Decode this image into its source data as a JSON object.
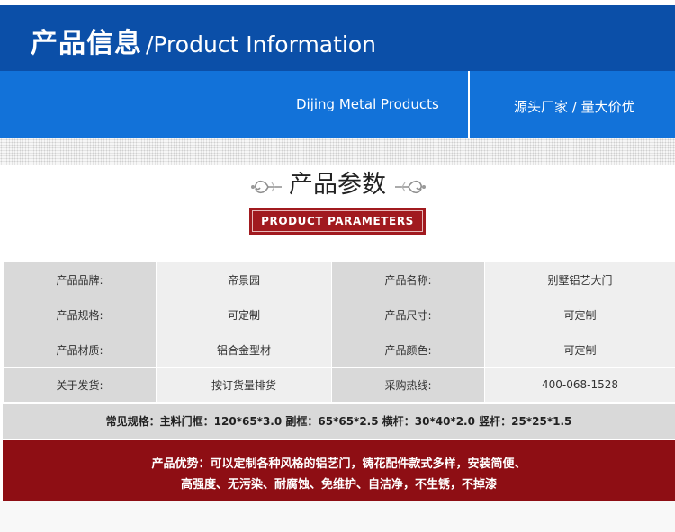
{
  "header": {
    "title_cn": "产品信息",
    "title_en": "/Product Information",
    "band_left": "Dijing Metal Products",
    "band_right": "源头厂家 / 量大价优"
  },
  "section": {
    "title": "产品参数",
    "badge": "PRODUCT PARAMETERS",
    "ornament_left_icon": "floral-scroll-left-icon",
    "ornament_right_icon": "floral-scroll-right-icon"
  },
  "params": {
    "rows": [
      {
        "label1": "产品品牌:",
        "value1": "帝景园",
        "label2": "产品名称:",
        "value2": "别墅铝艺大门"
      },
      {
        "label1": "产品规格:",
        "value1": "可定制",
        "label2": "产品尺寸:",
        "value2": "可定制"
      },
      {
        "label1": "产品材质:",
        "value1": "铝合金型材",
        "label2": "产品颜色:",
        "value2": "可定制"
      },
      {
        "label1": "关于发货:",
        "value1": "按订货量排货",
        "label2": "采购热线:",
        "value2": "400-068-1528"
      }
    ],
    "spec": "常见规格：主料门框：120*65*3.0 副框：65*65*2.5 横杆：30*40*2.0 竖杆：25*25*1.5"
  },
  "advantage": {
    "line1": "产品优势：可以定制各种风格的铝艺门，铸花配件款式多样，安装简便、",
    "line2": "高强度、无污染、耐腐蚀、免维护、自洁净，不生锈，不掉漆"
  },
  "colors": {
    "header_dark": "#0b4fa8",
    "header_band": "#1272d9",
    "accent_red": "#a11a1f",
    "advantage_red": "#8e0e14"
  }
}
